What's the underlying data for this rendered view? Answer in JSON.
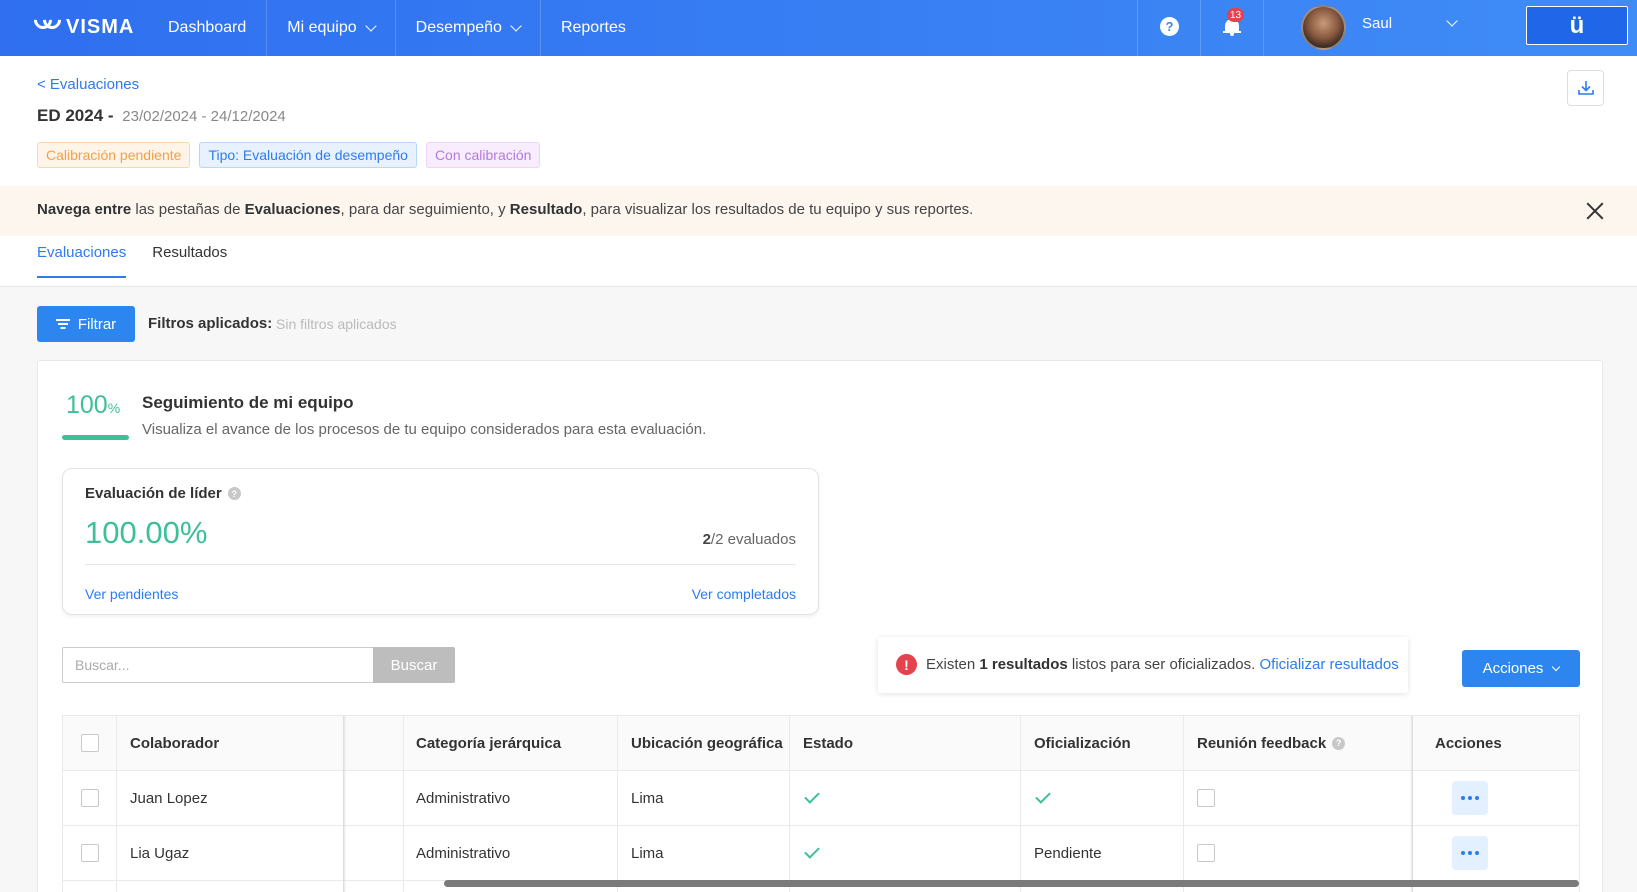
{
  "brand": {
    "logo_text": "VISMA"
  },
  "nav": {
    "items": [
      {
        "label": "Dashboard",
        "has_dropdown": false
      },
      {
        "label": "Mi equipo",
        "has_dropdown": true
      },
      {
        "label": "Desempeño",
        "has_dropdown": true
      },
      {
        "label": "Reportes",
        "has_dropdown": false
      }
    ],
    "help_icon": "help-icon",
    "notifications_count": "13",
    "user_name": "Saul",
    "app_button_glyph": "ü"
  },
  "header": {
    "back_link": "< Evaluaciones",
    "title": "ED 2024 -",
    "dates": "23/02/2024 - 24/12/2024",
    "tags": [
      "Calibración pendiente",
      "Tipo: Evaluación de desempeño",
      "Con calibración"
    ]
  },
  "banner": {
    "part1_bold": "Navega entre",
    "part2": " las pestañas de ",
    "part3_bold": "Evaluaciones",
    "part4": ", para dar seguimiento, y ",
    "part5_bold": "Resultado",
    "part6": ", para visualizar los resultados de tu equipo y sus reportes."
  },
  "tabs": [
    {
      "label": "Evaluaciones",
      "active": true
    },
    {
      "label": "Resultados",
      "active": false
    }
  ],
  "filters": {
    "button_label": "Filtrar",
    "applied_label": "Filtros aplicados:",
    "applied_value": "Sin filtros aplicados"
  },
  "tracking": {
    "percent_value": "100",
    "percent_symbol": "%",
    "progress_fraction": 1.0,
    "title": "Seguimiento de mi equipo",
    "subtitle": "Visualiza el avance de los procesos de tu equipo considerados para esta evaluación."
  },
  "leader_eval": {
    "title": "Evaluación de líder",
    "percent": "100.00%",
    "count_done": "2",
    "count_total": "/2 evaluados",
    "link_pending": "Ver pendientes",
    "link_done": "Ver completados"
  },
  "search": {
    "placeholder": "Buscar...",
    "button_label": "Buscar"
  },
  "alert": {
    "icon": "!",
    "text_pre": "Existen ",
    "text_bold": "1 resultados",
    "text_post": " listos para ser oficializados. ",
    "link": "Oficializar resultados"
  },
  "actions_button": "Acciones",
  "table": {
    "headers": {
      "colaborador": "Colaborador",
      "categoria": "Categoría jerárquica",
      "ubicacion": "Ubicación geográfica",
      "estado": "Estado",
      "oficializacion": "Oficialización",
      "reunion": "Reunión feedback",
      "acciones": "Acciones"
    },
    "rows": [
      {
        "colaborador": "Juan Lopez",
        "categoria": "Administrativo",
        "ubicacion": "Lima",
        "estado": "check",
        "oficializacion": "check",
        "oficializacion_text": "",
        "reunion_checked": false
      },
      {
        "colaborador": "Lia Ugaz",
        "categoria": "Administrativo",
        "ubicacion": "Lima",
        "estado": "check",
        "oficializacion": "text",
        "oficializacion_text": "Pendiente",
        "reunion_checked": false
      }
    ]
  },
  "colors": {
    "topbar_start": "#2f6ff0",
    "topbar_end": "#3f8cf6",
    "primary": "#2d86f0",
    "success": "#3dbf9a",
    "danger": "#e4424d",
    "warning_tag": "#f0a14a",
    "purple_tag": "#b37bd8"
  }
}
